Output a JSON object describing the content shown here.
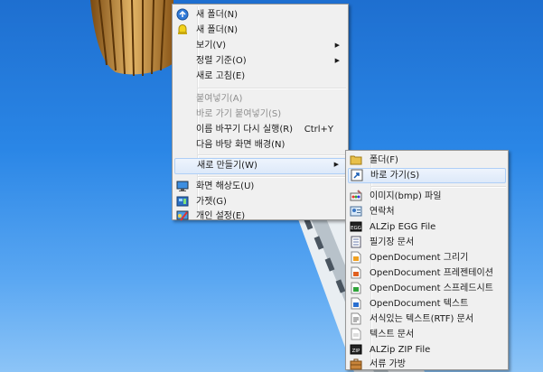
{
  "context_menu": {
    "items": [
      {
        "label": "새 폴더(N)",
        "icon": "blue-globe-icon"
      },
      {
        "label": "새 폴더(N)",
        "icon": "yellow-bell-icon"
      },
      {
        "label": "보기(V)"
      },
      {
        "label": "정렬 기준(O)"
      },
      {
        "label": "새로 고침(E)"
      },
      {
        "label": "붙여넣기(A)"
      },
      {
        "label": "바로 가기 붙여넣기(S)"
      },
      {
        "label": "이름 바꾸기 다시 실행(R)",
        "shortcut": "Ctrl+Y"
      },
      {
        "label": "다음 바탕 화면 배경(N)"
      },
      {
        "label": "새로 만들기(W)"
      },
      {
        "label": "화면 해상도(U)",
        "icon": "monitor-icon"
      },
      {
        "label": "가젯(G)",
        "icon": "gadget-icon"
      },
      {
        "label": "개인 설정(E)",
        "icon": "personalize-icon"
      }
    ],
    "submenu_arrow": "▶"
  },
  "new_submenu": {
    "items": [
      {
        "label": "폴더(F)",
        "icon": "folder-icon"
      },
      {
        "label": "바로 가기(S)",
        "icon": "shortcut-icon"
      },
      {
        "label": "이미지(bmp) 파일",
        "icon": "paint-icon"
      },
      {
        "label": "연락처",
        "icon": "contact-icon"
      },
      {
        "label": "ALZip EGG File",
        "icon": "egg-file-icon"
      },
      {
        "label": "필기장 문서",
        "icon": "journal-icon"
      },
      {
        "label": "OpenDocument 그리기",
        "icon": "odg-icon"
      },
      {
        "label": "OpenDocument 프레젠테이션",
        "icon": "odp-icon"
      },
      {
        "label": "OpenDocument 스프레드시트",
        "icon": "ods-icon"
      },
      {
        "label": "OpenDocument 텍스트",
        "icon": "odt-icon"
      },
      {
        "label": "서식있는 텍스트(RTF) 문서",
        "icon": "rtf-icon"
      },
      {
        "label": "텍스트 문서",
        "icon": "text-doc-icon"
      },
      {
        "label": "ALZip ZIP File",
        "icon": "zip-file-icon"
      },
      {
        "label": "서류 가방",
        "icon": "briefcase-icon"
      }
    ]
  }
}
